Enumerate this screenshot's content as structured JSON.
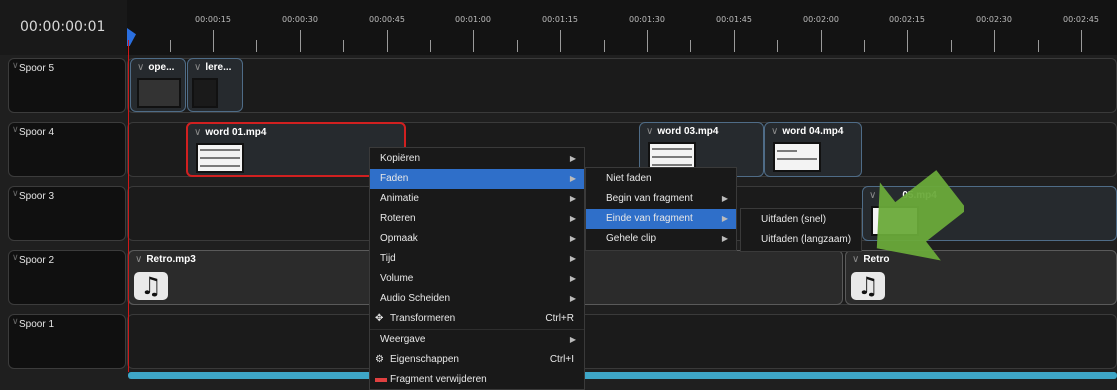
{
  "timecode": "00:00:00:01",
  "ruler": {
    "labels": [
      "00:00:15",
      "00:00:30",
      "00:00:45",
      "00:01:00",
      "00:01:15",
      "00:01:30",
      "00:01:45",
      "00:02:00",
      "00:02:15",
      "00:02:30",
      "00:02:45"
    ]
  },
  "tracks": [
    {
      "name": "Spoor 5"
    },
    {
      "name": "Spoor 4"
    },
    {
      "name": "Spoor 3"
    },
    {
      "name": "Spoor 2"
    },
    {
      "name": "Spoor 1"
    }
  ],
  "clips": {
    "ope": "ope...",
    "lere": "lere...",
    "word01": "word 01.mp4",
    "word03": "word 03.mp4",
    "word04": "word 04.mp4",
    "word05": "05.mp4",
    "retro1": "Retro.mp3",
    "retro2": "Retro"
  },
  "context_menu": {
    "items": [
      {
        "label": "Kopiëren",
        "submenu": true
      },
      {
        "label": "Faden",
        "submenu": true
      },
      {
        "label": "Animatie",
        "submenu": true
      },
      {
        "label": "Roteren",
        "submenu": true
      },
      {
        "label": "Opmaak",
        "submenu": true
      },
      {
        "label": "Tijd",
        "submenu": true
      },
      {
        "label": "Volume",
        "submenu": true
      },
      {
        "label": "Audio Scheiden",
        "submenu": true
      },
      {
        "label": "Transformeren",
        "shortcut": "Ctrl+R"
      },
      {
        "label": "Weergave",
        "submenu": true
      },
      {
        "label": "Eigenschappen",
        "shortcut": "Ctrl+I"
      },
      {
        "label": "Fragment verwijderen"
      }
    ]
  },
  "faden_menu": {
    "items": [
      {
        "label": "Niet faden"
      },
      {
        "label": "Begin van fragment",
        "submenu": true
      },
      {
        "label": "Einde van fragment",
        "submenu": true
      },
      {
        "label": "Gehele clip",
        "submenu": true
      }
    ]
  },
  "einde_menu": {
    "items": [
      {
        "label": "Uitfaden (snel)"
      },
      {
        "label": "Uitfaden (langzaam)"
      }
    ]
  },
  "colors": {
    "highlight": "#2f6fc9",
    "playhead": "#cc1818",
    "scrollbar": "#3ea6c7",
    "arrow": "#6aaa3a"
  },
  "icons": {
    "track_chevron": "chevron-down-icon",
    "transform": "move-arrows-icon",
    "properties": "gear-icon",
    "delete": "remove-bar-icon",
    "audio": "music-note-icon"
  }
}
